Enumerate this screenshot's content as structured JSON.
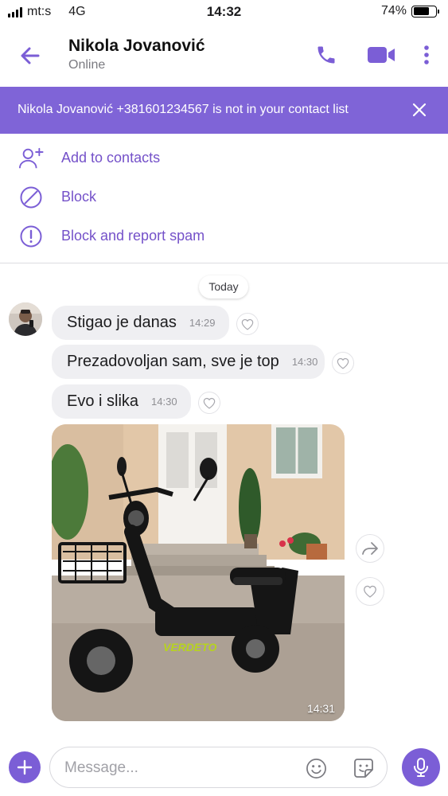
{
  "status_bar": {
    "carrier": "mt:s",
    "network": "4G",
    "time": "14:32",
    "battery": "74%",
    "battery_level": 0.74
  },
  "header": {
    "contact_name": "Nikola Jovanović",
    "contact_status": "Online",
    "icons": [
      "back-arrow-icon",
      "phone-icon",
      "video-camera-icon",
      "more-vertical-icon"
    ]
  },
  "banner": {
    "text": "Nikola Jovanović +381601234567 is not in your contact list"
  },
  "actions": {
    "add_contact": "Add to contacts",
    "block": "Block",
    "block_report": "Block and report spam"
  },
  "chat": {
    "date_separator": "Today",
    "messages": [
      {
        "text": "Stigao je danas",
        "time": "14:29"
      },
      {
        "text": "Prezadovoljan sam, sve je top",
        "time": "14:30"
      },
      {
        "text": "Evo i slika",
        "time": "14:30"
      }
    ],
    "photo_message": {
      "time": "14:31",
      "brand_text": "VERDETO"
    }
  },
  "composer": {
    "placeholder": "Message..."
  },
  "colors": {
    "accent": "#7b5ed6",
    "banner": "#7f64d7",
    "link": "#7451c9",
    "bubble": "#efeff2"
  }
}
